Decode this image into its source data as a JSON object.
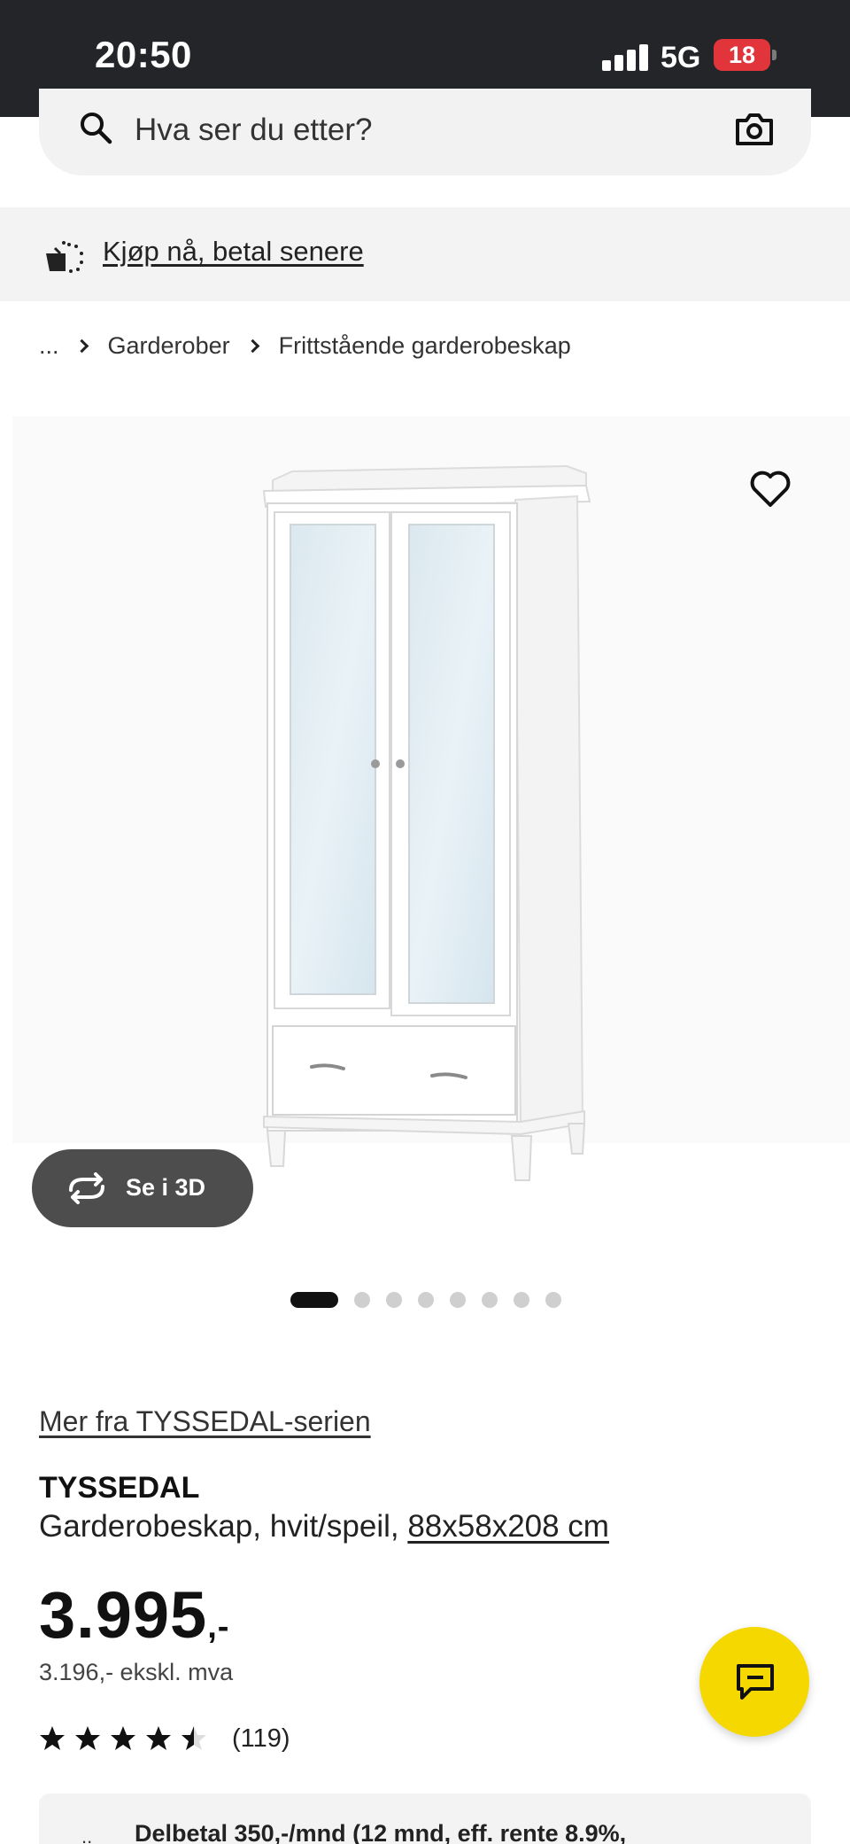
{
  "status_bar": {
    "time": "20:50",
    "network": "5G",
    "battery": "18"
  },
  "search": {
    "placeholder": "Hva ser du etter?",
    "search_icon": "search-icon",
    "camera_icon": "camera-icon"
  },
  "promo": {
    "label": "Kjøp nå, betal senere",
    "icon": "shopping-bag-icon"
  },
  "breadcrumb": {
    "ellipsis": "...",
    "items": [
      "Garderober",
      "Frittstående garderobeskap"
    ]
  },
  "gallery": {
    "view_3d_label": "Se i 3D",
    "image_count": 8,
    "active_index": 0
  },
  "product": {
    "series_link": "Mer fra TYSSEDAL-serien",
    "name": "TYSSEDAL",
    "description": "Garderobeskap, hvit/speil, ",
    "size": "88x58x208 cm",
    "price": "3.995",
    "price_suffix": ",-",
    "price_excl_vat": "3.196,- ekskl. mva",
    "rating": 4.5,
    "review_count": "(119)"
  },
  "installment": {
    "icon_text": "..",
    "text": "Delbetal 350,-/mnd (12 mnd, eff. rente 8.9%,"
  },
  "colors": {
    "status_bar": "#232529",
    "accent_yellow": "#f5d800",
    "battery_red": "#e2353b",
    "button_dark": "#4d4d4d"
  }
}
